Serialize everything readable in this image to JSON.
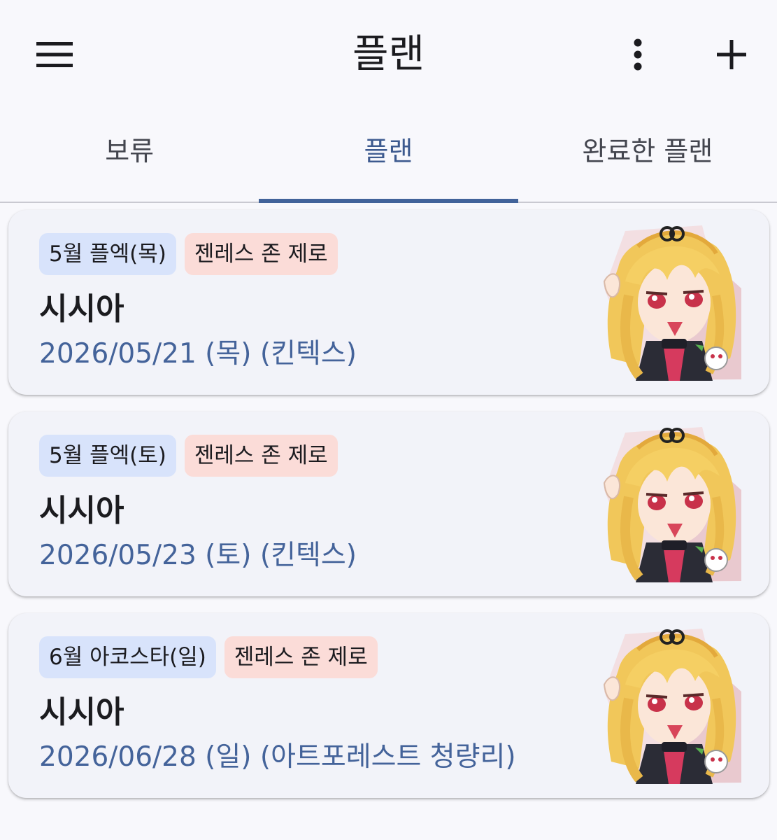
{
  "header": {
    "title": "플랜",
    "menu_icon": "hamburger-menu-icon",
    "more_icon": "more-vertical-icon",
    "add_icon": "plus-icon"
  },
  "tabs": [
    {
      "label": "보류",
      "active": false
    },
    {
      "label": "플랜",
      "active": true
    },
    {
      "label": "완료한 플랜",
      "active": false
    }
  ],
  "colors": {
    "accent": "#42639a",
    "chip_event": "#d8e3fb",
    "chip_game": "#fbdcd8"
  },
  "plans": [
    {
      "event_tag": "5월 플엑(목)",
      "game_tag": "젠레스 존 제로",
      "character": "시시아",
      "date": "2026/05/21 (목) (킨텍스)"
    },
    {
      "event_tag": "5월 플엑(토)",
      "game_tag": "젠레스 존 제로",
      "character": "시시아",
      "date": "2026/05/23 (토) (킨텍스)"
    },
    {
      "event_tag": "6월 아코스타(일)",
      "game_tag": "젠레스 존 제로",
      "character": "시시아",
      "date": "2026/06/28 (일) (아트포레스트 청량리)"
    }
  ]
}
